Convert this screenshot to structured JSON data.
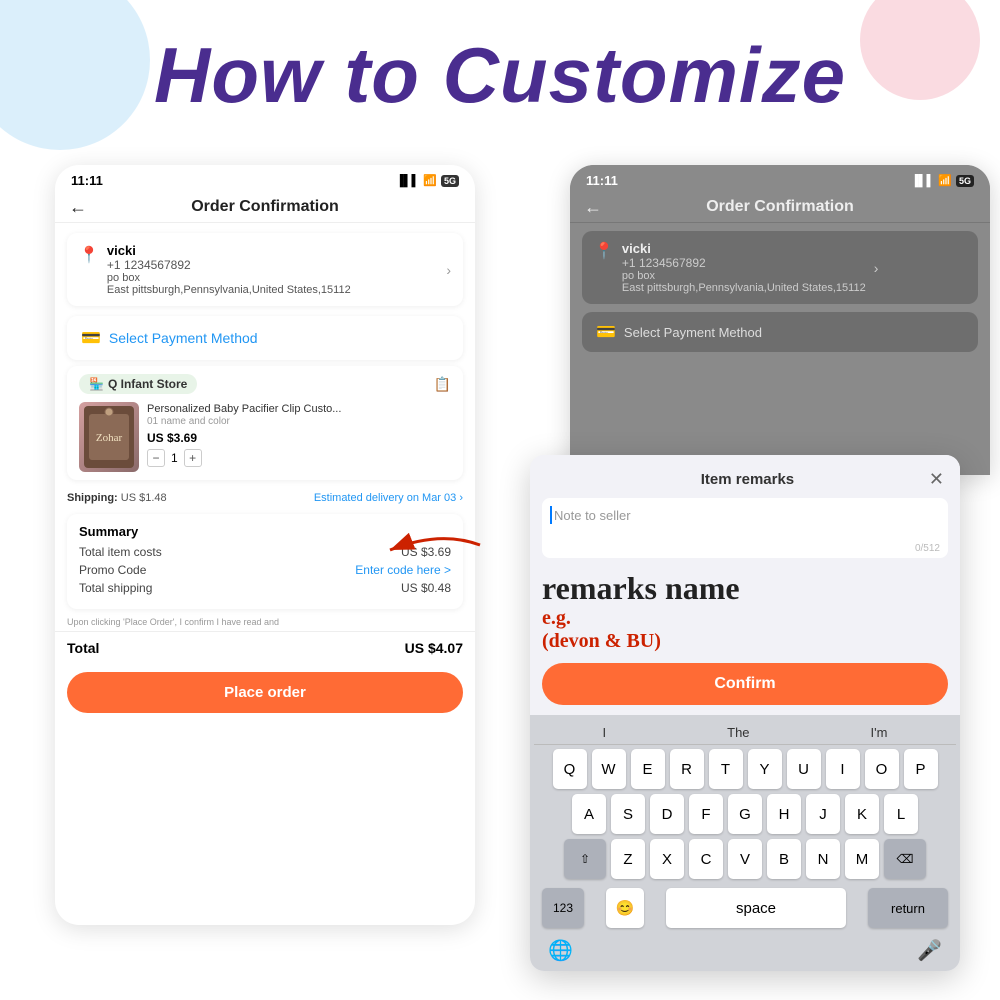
{
  "page": {
    "title": "How to Customize",
    "bg_circle_colors": [
      "#b8e0f7",
      "#f5b8c4"
    ]
  },
  "phone_left": {
    "status": {
      "time": "11:11",
      "signal": "▐▌▌",
      "wifi": "WiFi",
      "cell": "5G"
    },
    "nav": {
      "back": "←",
      "title": "Order Confirmation"
    },
    "address": {
      "name": "vicki",
      "phone": "+1 1234567892",
      "po": "po box",
      "city": "East pittsburgh,Pennsylvania,United States,15112"
    },
    "payment": {
      "label": "Select Payment Method"
    },
    "store": {
      "name": "Q Infant Store"
    },
    "product": {
      "name": "Personalized Baby Pacifier Clip Custo...",
      "variant": "01 name and color",
      "price": "US $3.69",
      "qty": "1"
    },
    "shipping": {
      "label": "Shipping:",
      "price": "US $1.48",
      "delivery": "Estimated delivery on Mar 03"
    },
    "summary": {
      "title": "Summary",
      "item_costs_label": "Total item costs",
      "item_costs_value": "US $3.69",
      "promo_label": "Promo Code",
      "promo_value": "Enter code here >",
      "shipping_label": "Total shipping",
      "shipping_value": "US $0.48"
    },
    "legal": "Upon clicking 'Place Order', I confirm I have read and",
    "total_label": "Total",
    "total_value": "US $4.07",
    "place_order_btn": "Place order"
  },
  "phone_right": {
    "status": {
      "time": "11:11",
      "signal": "▐▌▌",
      "wifi": "WiFi",
      "cell": "5G"
    },
    "nav": {
      "back": "←",
      "title": "Order Confirmation"
    },
    "address": {
      "name": "vicki",
      "phone": "+1 1234567892",
      "po": "po box",
      "city": "East pittsburgh,Pennsylvania,United States,15112"
    },
    "payment": {
      "label": "Select Payment Method"
    }
  },
  "modal": {
    "title": "Item remarks",
    "close": "✕",
    "placeholder": "Note to seller",
    "char_count": "0/512",
    "confirm_btn": "Confirm"
  },
  "annotation": {
    "remarks_name": "remarks name",
    "eg_label": "e.g.",
    "eg_value": "(devon & BU)"
  },
  "keyboard": {
    "suggestions": [
      "I",
      "The",
      "I'm"
    ],
    "row1": [
      "Q",
      "W",
      "E",
      "R",
      "T",
      "Y",
      "U",
      "I",
      "O",
      "P"
    ],
    "row2": [
      "A",
      "S",
      "D",
      "F",
      "G",
      "H",
      "J",
      "K",
      "L"
    ],
    "row3": [
      "Z",
      "X",
      "C",
      "V",
      "B",
      "N",
      "M"
    ],
    "space": "space",
    "return_key": "return",
    "shift": "⇧",
    "delete": "⌫",
    "num": "123",
    "emoji": "😊",
    "globe": "🌐",
    "mic": "🎤"
  }
}
